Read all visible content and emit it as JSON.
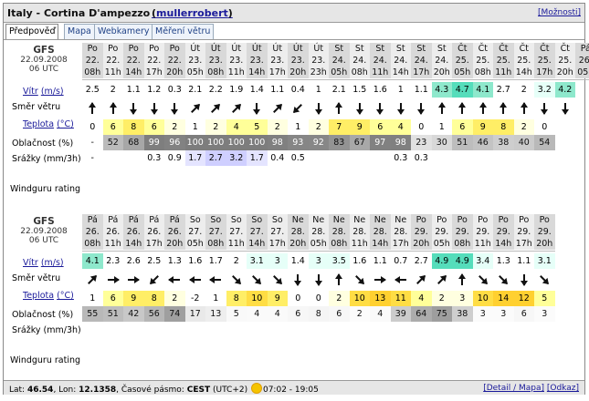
{
  "header": {
    "title": "Italy - Cortina D'ampezzo",
    "user": "mullerrobert",
    "options": "[Možnosti]"
  },
  "tabs": [
    "Předpověď",
    "Mapa",
    "Webkamery",
    "Měření větru"
  ],
  "labels": {
    "wind": "Vítr",
    "wind_unit": "(m/s)",
    "direction": "Směr větru",
    "temp": "Teplota",
    "temp_unit": "(°C)",
    "cloud": "Oblačnost (%)",
    "rain": "Srážky (mm/3h)",
    "rating": "Windguru rating"
  },
  "sections": [
    {
      "model": "GFS",
      "date": "22.09.2008",
      "utc": "06 UTC",
      "days": [
        "Po",
        "Po",
        "Po",
        "Po",
        "Po",
        "Út",
        "Út",
        "Út",
        "Út",
        "Út",
        "Út",
        "Út",
        "St",
        "St",
        "St",
        "St",
        "St",
        "St",
        "Čt",
        "Čt",
        "Čt",
        "Čt",
        "Čt",
        "Čt",
        "Pá"
      ],
      "dates": [
        "22.",
        "22.",
        "22.",
        "22.",
        "22.",
        "23.",
        "23.",
        "23.",
        "23.",
        "23.",
        "23.",
        "23.",
        "24.",
        "24.",
        "24.",
        "24.",
        "24.",
        "24.",
        "25.",
        "25.",
        "25.",
        "25.",
        "25.",
        "25.",
        "26."
      ],
      "hours": [
        "08h",
        "11h",
        "14h",
        "17h",
        "20h",
        "05h",
        "08h",
        "11h",
        "14h",
        "17h",
        "20h",
        "23h",
        "05h",
        "08h",
        "11h",
        "14h",
        "17h",
        "20h",
        "05h",
        "08h",
        "11h",
        "14h",
        "17h",
        "20h",
        "05h"
      ],
      "wind": [
        "2.5",
        "2",
        "1.1",
        "1.2",
        "0.3",
        "2.1",
        "2.2",
        "1.9",
        "1.4",
        "1.1",
        "0.4",
        "1",
        "2.1",
        "1.5",
        "1.6",
        "1",
        "1.1",
        "4.3",
        "4.7",
        "4.1",
        "2.7",
        "2",
        "3.2",
        "4.2"
      ],
      "dirs": [
        180,
        180,
        0,
        0,
        0,
        225,
        225,
        225,
        0,
        225,
        45,
        0,
        180,
        0,
        0,
        0,
        0,
        180,
        180,
        180,
        180,
        180,
        0,
        0
      ],
      "temp": [
        "0",
        "6",
        "8",
        "6",
        "2",
        "1",
        "2",
        "4",
        "5",
        "2",
        "1",
        "2",
        "7",
        "9",
        "6",
        "4",
        "0",
        "1",
        "6",
        "9",
        "8",
        "2",
        "0"
      ],
      "cloud": [
        "-",
        "52",
        "68",
        "99",
        "96",
        "100",
        "100",
        "100",
        "100",
        "98",
        "93",
        "92",
        "83",
        "67",
        "97",
        "98",
        "23",
        "30",
        "51",
        "46",
        "38",
        "40",
        "54"
      ],
      "rain": [
        "-",
        "",
        "",
        "0.3",
        "0.9",
        "1.7",
        "2.7",
        "3.2",
        "1.7",
        "0.4",
        "0.5",
        "",
        "",
        "",
        "",
        "0.3",
        "0.3",
        "",
        "",
        "",
        "",
        "",
        ""
      ]
    },
    {
      "model": "GFS",
      "date": "22.09.2008",
      "utc": "06 UTC",
      "days": [
        "Pá",
        "Pá",
        "Pá",
        "Pá",
        "Pá",
        "So",
        "So",
        "So",
        "So",
        "So",
        "Ne",
        "Ne",
        "Ne",
        "Ne",
        "Ne",
        "Ne",
        "Po",
        "Po",
        "Po",
        "Po",
        "Po",
        "Po",
        "Po"
      ],
      "dates": [
        "26.",
        "26.",
        "26.",
        "26.",
        "26.",
        "27.",
        "27.",
        "27.",
        "27.",
        "27.",
        "28.",
        "28.",
        "28.",
        "28.",
        "28.",
        "28.",
        "29.",
        "29.",
        "29.",
        "29.",
        "29.",
        "29.",
        "29."
      ],
      "hours": [
        "08h",
        "11h",
        "14h",
        "17h",
        "20h",
        "05h",
        "08h",
        "11h",
        "14h",
        "17h",
        "20h",
        "05h",
        "08h",
        "11h",
        "14h",
        "17h",
        "20h",
        "05h",
        "08h",
        "11h",
        "14h",
        "17h",
        "20h"
      ],
      "wind": [
        "4.1",
        "2.3",
        "2.6",
        "2.5",
        "1.3",
        "1.6",
        "1.7",
        "2",
        "3.1",
        "3",
        "1.4",
        "3",
        "3.5",
        "1.6",
        "1.1",
        "0.7",
        "2.7",
        "4.9",
        "4.9",
        "3.4",
        "1.3",
        "1.1",
        "3.1"
      ],
      "dirs": [
        225,
        270,
        270,
        45,
        90,
        90,
        90,
        315,
        315,
        315,
        0,
        0,
        180,
        315,
        270,
        90,
        225,
        225,
        180,
        315,
        315,
        0,
        315
      ],
      "temp": [
        "1",
        "6",
        "9",
        "8",
        "2",
        "-2",
        "1",
        "8",
        "10",
        "9",
        "0",
        "0",
        "2",
        "10",
        "13",
        "11",
        "4",
        "2",
        "3",
        "10",
        "14",
        "12",
        "5"
      ],
      "cloud": [
        "55",
        "51",
        "42",
        "56",
        "74",
        "17",
        "13",
        "5",
        "4",
        "4",
        "6",
        "8",
        "6",
        "2",
        "4",
        "39",
        "64",
        "75",
        "38",
        "3",
        "3",
        "6",
        "3"
      ],
      "rain": [
        "",
        "",
        "",
        "",
        "",
        "",
        "",
        "",
        "",
        "",
        "",
        "",
        "",
        "",
        "",
        "",
        "",
        "",
        "",
        "",
        "",
        "",
        ""
      ]
    }
  ],
  "footer": {
    "lat_label": "Lat:",
    "lat": "46.54",
    "lon_label": "Lon:",
    "lon": "12.1358",
    "tz_label": "Časové pásmo:",
    "tz": "CEST",
    "tz_offset": "(UTC+2)",
    "sun_times": "07:02 - 19:05",
    "detail_link": "[Detail / Mapa]",
    "link_link": "[Odkaz]"
  },
  "colors": {
    "temp_scale": [
      "#ffffff",
      "#ffffe0",
      "#ffff99",
      "#ffee66",
      "#ffdd33"
    ],
    "cloud_dark": "#6f6f6f",
    "wind_strong": "#55ddbb",
    "rain_light": "#d6d6ff"
  }
}
